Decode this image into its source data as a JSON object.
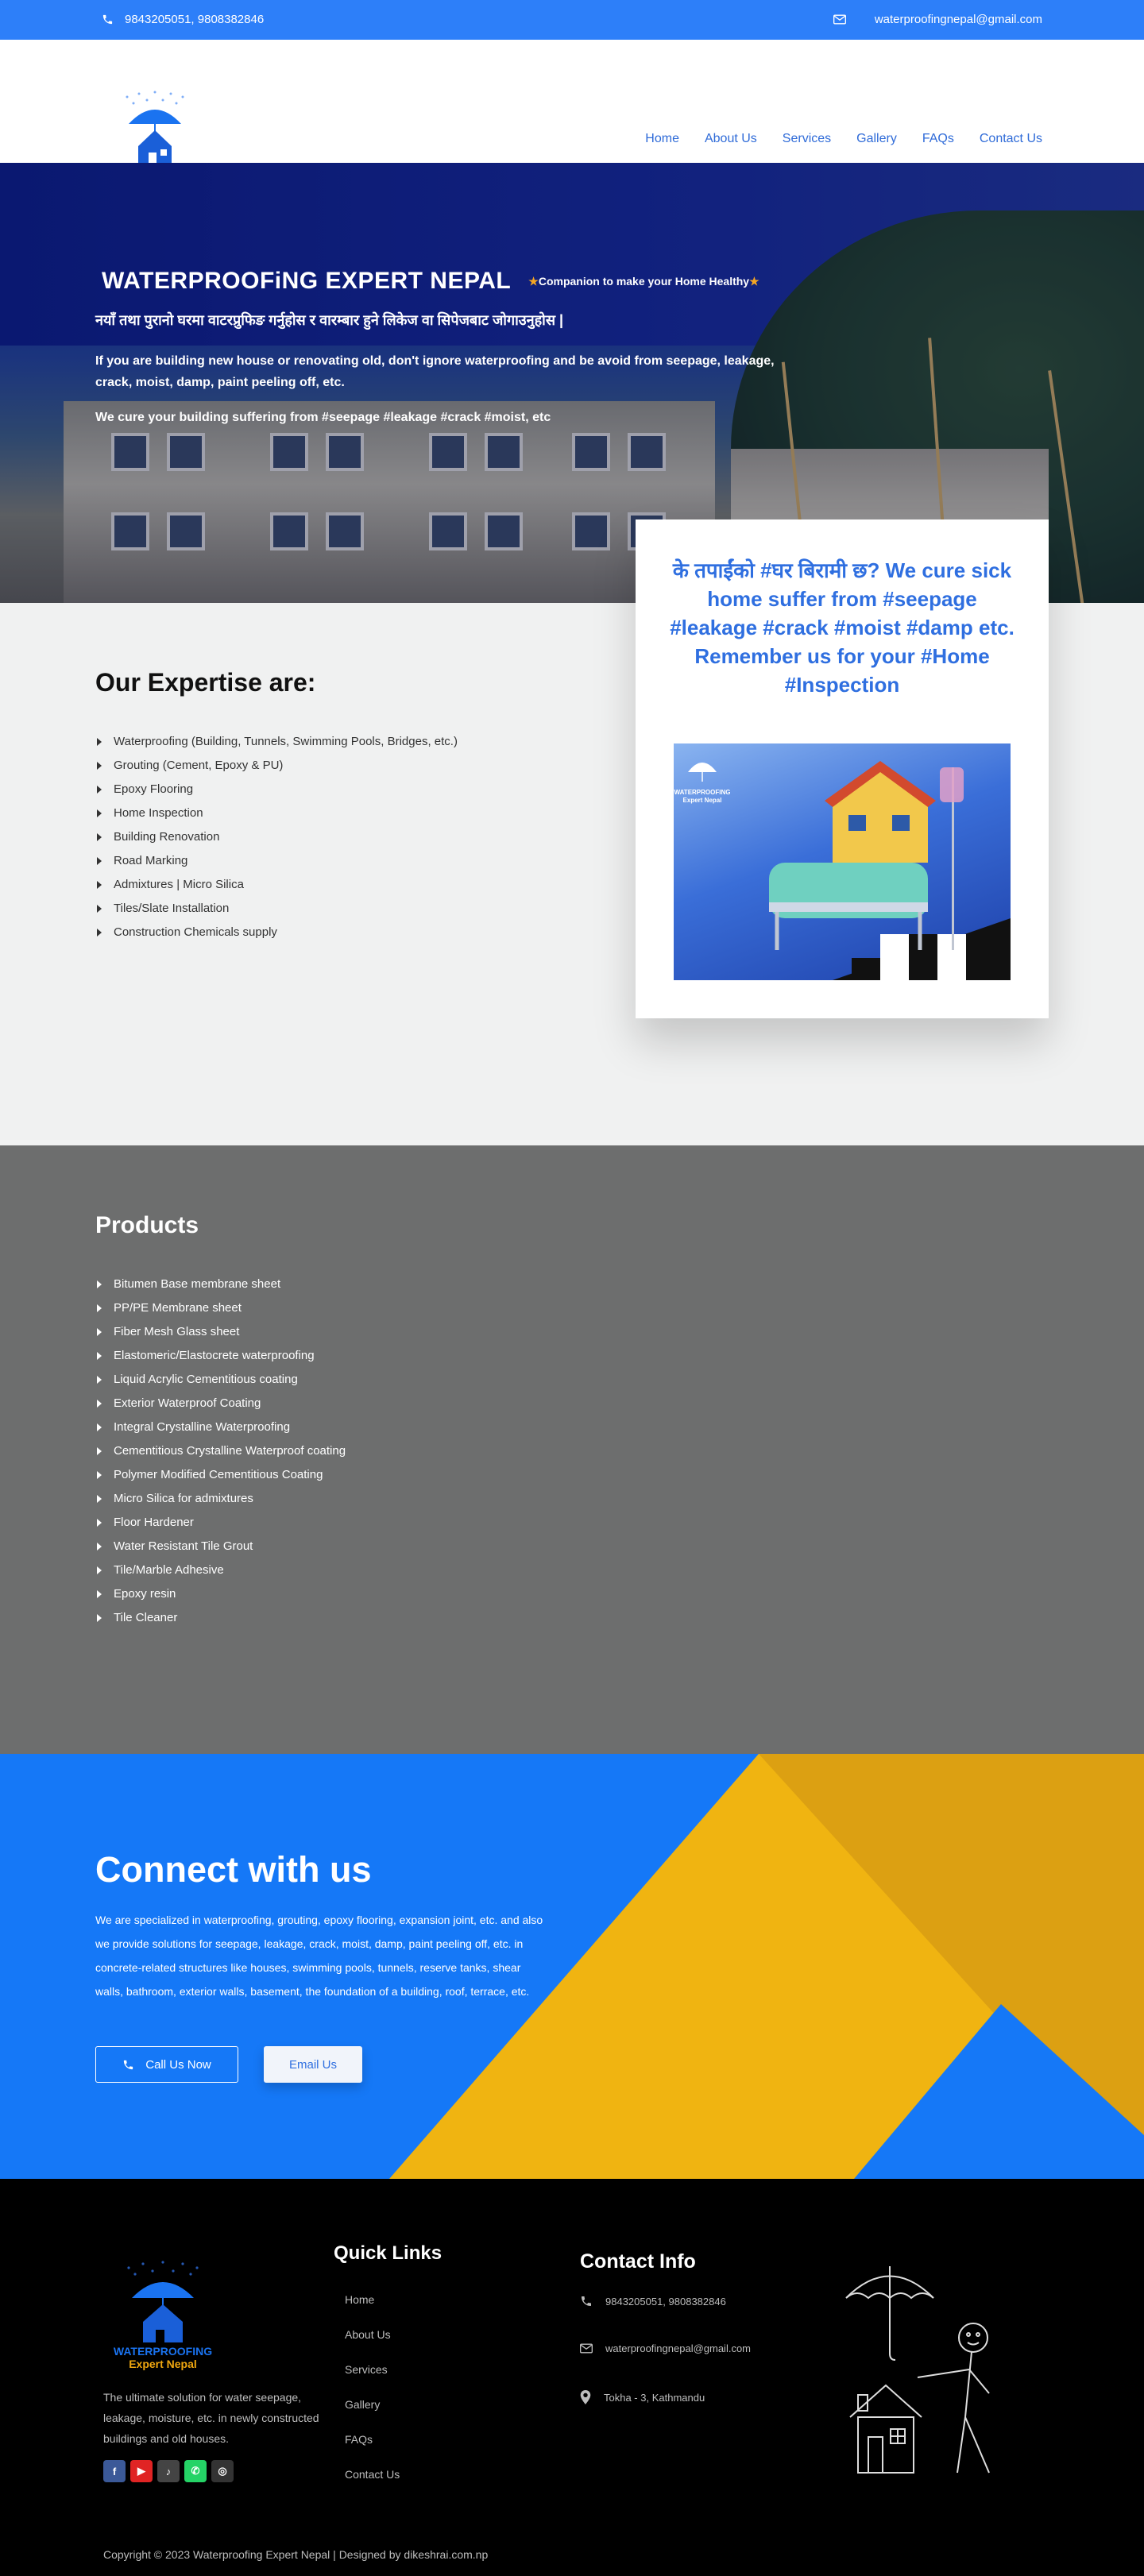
{
  "topbar": {
    "phones": "9843205051, 9808382846",
    "email": "waterproofingnepal@gmail.com"
  },
  "logo": {
    "line1": "WATERPROOFING",
    "line2": "Expert Nepal"
  },
  "nav": [
    "Home",
    "About Us",
    "Services",
    "Gallery",
    "FAQs",
    "Contact Us"
  ],
  "hero": {
    "title": "WATERPROOFiNG EXPERT NEPAL",
    "tagline": "Companion to make your Home Healthy",
    "nepali": "नयाँ तथा पुरानो घरमा वाटरप्रुफिङ गर्नुहोस र वारम्बार हुने लिकेज वा सिपेजबाट जोगाउनुहोस |",
    "p1": "If you are building new house or renovating old, don't ignore waterproofing and be avoid from seepage, leakage, crack, moist, damp, paint peeling off, etc.",
    "p2": "We cure your building suffering from #seepage #leakage #crack #moist, etc"
  },
  "expertise": {
    "title": "Our Expertise are:",
    "items": [
      "Waterproofing (Building, Tunnels, Swimming Pools, Bridges, etc.)",
      "Grouting (Cement, Epoxy & PU)",
      "Epoxy Flooring",
      "Home Inspection",
      "Building Renovation",
      "Road Marking",
      "Admixtures | Micro Silica",
      "Tiles/Slate Installation",
      "Construction Chemicals supply"
    ]
  },
  "card": {
    "line1": "के तपाईंको #घर बिरामी छ? We cure sick home suffer from #seepage #leakage #crack #moist #damp etc.",
    "line2": "Remember us for your #Home #Inspection"
  },
  "products": {
    "title": "Products",
    "items": [
      "Bitumen Base membrane sheet",
      "PP/PE Membrane sheet",
      "Fiber Mesh Glass sheet",
      "Elastomeric/Elastocrete waterproofing",
      "Liquid Acrylic Cementitious coating",
      "Exterior Waterproof Coating",
      "Integral Crystalline Waterproofing",
      "Cementitious Crystalline Waterproof coating",
      "Polymer Modified Cementitious Coating",
      "Micro Silica for admixtures",
      "Floor Hardener",
      "Water Resistant Tile Grout",
      "Tile/Marble Adhesive",
      "Epoxy resin",
      "Tile Cleaner"
    ]
  },
  "connect": {
    "title": "Connect with us",
    "text": "We are specialized in waterproofing, grouting, epoxy flooring, expansion joint, etc. and also we provide solutions for seepage, leakage, crack, moist, damp, paint peeling off, etc. in concrete-related structures like houses, swimming pools, tunnels, reserve tanks, shear walls,  bathroom, exterior walls, basement, the foundation of a building, roof, terrace, etc.",
    "call_label": "Call Us Now",
    "email_label": "Email Us"
  },
  "footer": {
    "desc": "The ultimate solution for water seepage, leakage, moisture, etc. in newly constructed buildings and old houses.",
    "social": [
      "facebook-icon",
      "youtube-icon",
      "tiktok-icon",
      "whatsapp-icon",
      "instagram-icon"
    ],
    "quick_links_title": "Quick Links",
    "quick_links": [
      "Home",
      "About Us",
      "Services",
      "Gallery",
      "FAQs",
      "Contact Us"
    ],
    "contact_title": "Contact Info",
    "contact_phone": "9843205051, 9808382846",
    "contact_email": "waterproofingnepal@gmail.com",
    "contact_address": "Tokha - 3, Kathmandu",
    "copyright": "Copyright © 2023 Waterproofing Expert Nepal | Designed by dikeshrai.com.np"
  },
  "colors": {
    "brand_blue": "#2d7ff9",
    "accent_yellow": "#f0b411",
    "dark_yellow": "#dca012"
  }
}
